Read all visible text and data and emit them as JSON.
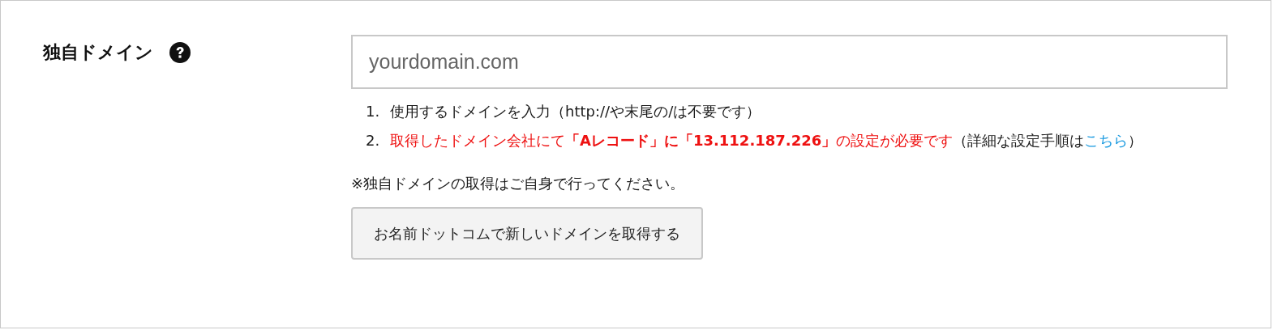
{
  "field": {
    "label": "独自ドメイン",
    "help": true,
    "placeholder": "yourdomain.com"
  },
  "instructions": [
    {
      "number": "1.",
      "kind": "plain",
      "text": "使用するドメインを入力（http://や末尾の/は不要です）"
    },
    {
      "number": "2.",
      "kind": "warning",
      "warning": "取得したドメイン会社にて**「Aレコード」に「13.112.187.226」**の設定が必要です",
      "text": "（詳細な設定手順は",
      "link": "こちら",
      "after": "）"
    }
  ],
  "note": "※独自ドメインの取得はご自身で行ってください。",
  "button": "お名前ドットコムで新しいドメインを取得する"
}
